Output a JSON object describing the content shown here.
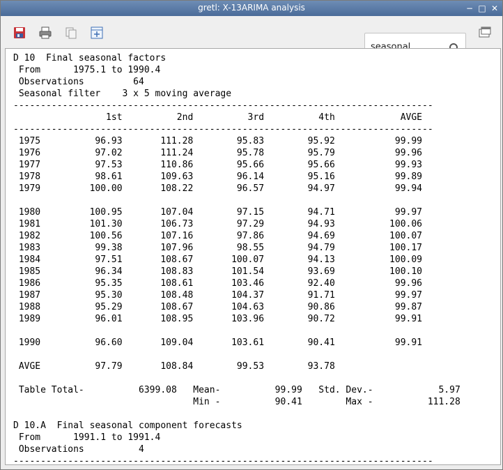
{
  "window": {
    "title": "gretl: X-13ARIMA analysis",
    "minimize": "−",
    "maximize": "□",
    "close": "✕"
  },
  "toolbar": {
    "icons": [
      "save-icon",
      "print-icon",
      "copy-icon",
      "add-to-dataset-icon",
      "open-window-icon"
    ],
    "search_value": "seasonal"
  },
  "output": {
    "text": "D 10  Final seasonal factors\n From      1975.1 to 1990.4\n Observations         64\n Seasonal filter    3 x 5 moving average\n-----------------------------------------------------------------------------\n                 1st          2nd          3rd          4th            AVGE\n-----------------------------------------------------------------------------\n 1975          96.93       111.28        95.83        95.92           99.99\n 1976          97.02       111.24        95.78        95.79           99.96\n 1977          97.53       110.86        95.66        95.66           99.93\n 1978          98.61       109.63        96.14        95.16           99.89\n 1979         100.00       108.22        96.57        94.97           99.94\n\n 1980         100.95       107.04        97.15        94.71           99.97\n 1981         101.30       106.73        97.29        94.93          100.06\n 1982         100.56       107.16        97.86        94.69          100.07\n 1983          99.38       107.96        98.55        94.79          100.17\n 1984          97.51       108.67       100.07        94.13          100.09\n 1985          96.34       108.83       101.54        93.69          100.10\n 1986          95.35       108.61       103.46        92.40           99.96\n 1987          95.30       108.48       104.37        91.71           99.97\n 1988          95.29       108.67       104.63        90.86           99.87\n 1989          96.01       108.95       103.96        90.72           99.91\n\n 1990          96.60       109.04       103.61        90.41           99.91\n\n AVGE          97.79       108.84        99.53        93.78\n\n Table Total-          6399.08   Mean-          99.99   Std. Dev.-            5.97\n                                 Min -          90.41        Max -          111.28\n\nD 10.A  Final seasonal component forecasts\n From      1991.1 to 1991.4\n Observations          4\n-----------------------------------------------------------------------------"
  }
}
